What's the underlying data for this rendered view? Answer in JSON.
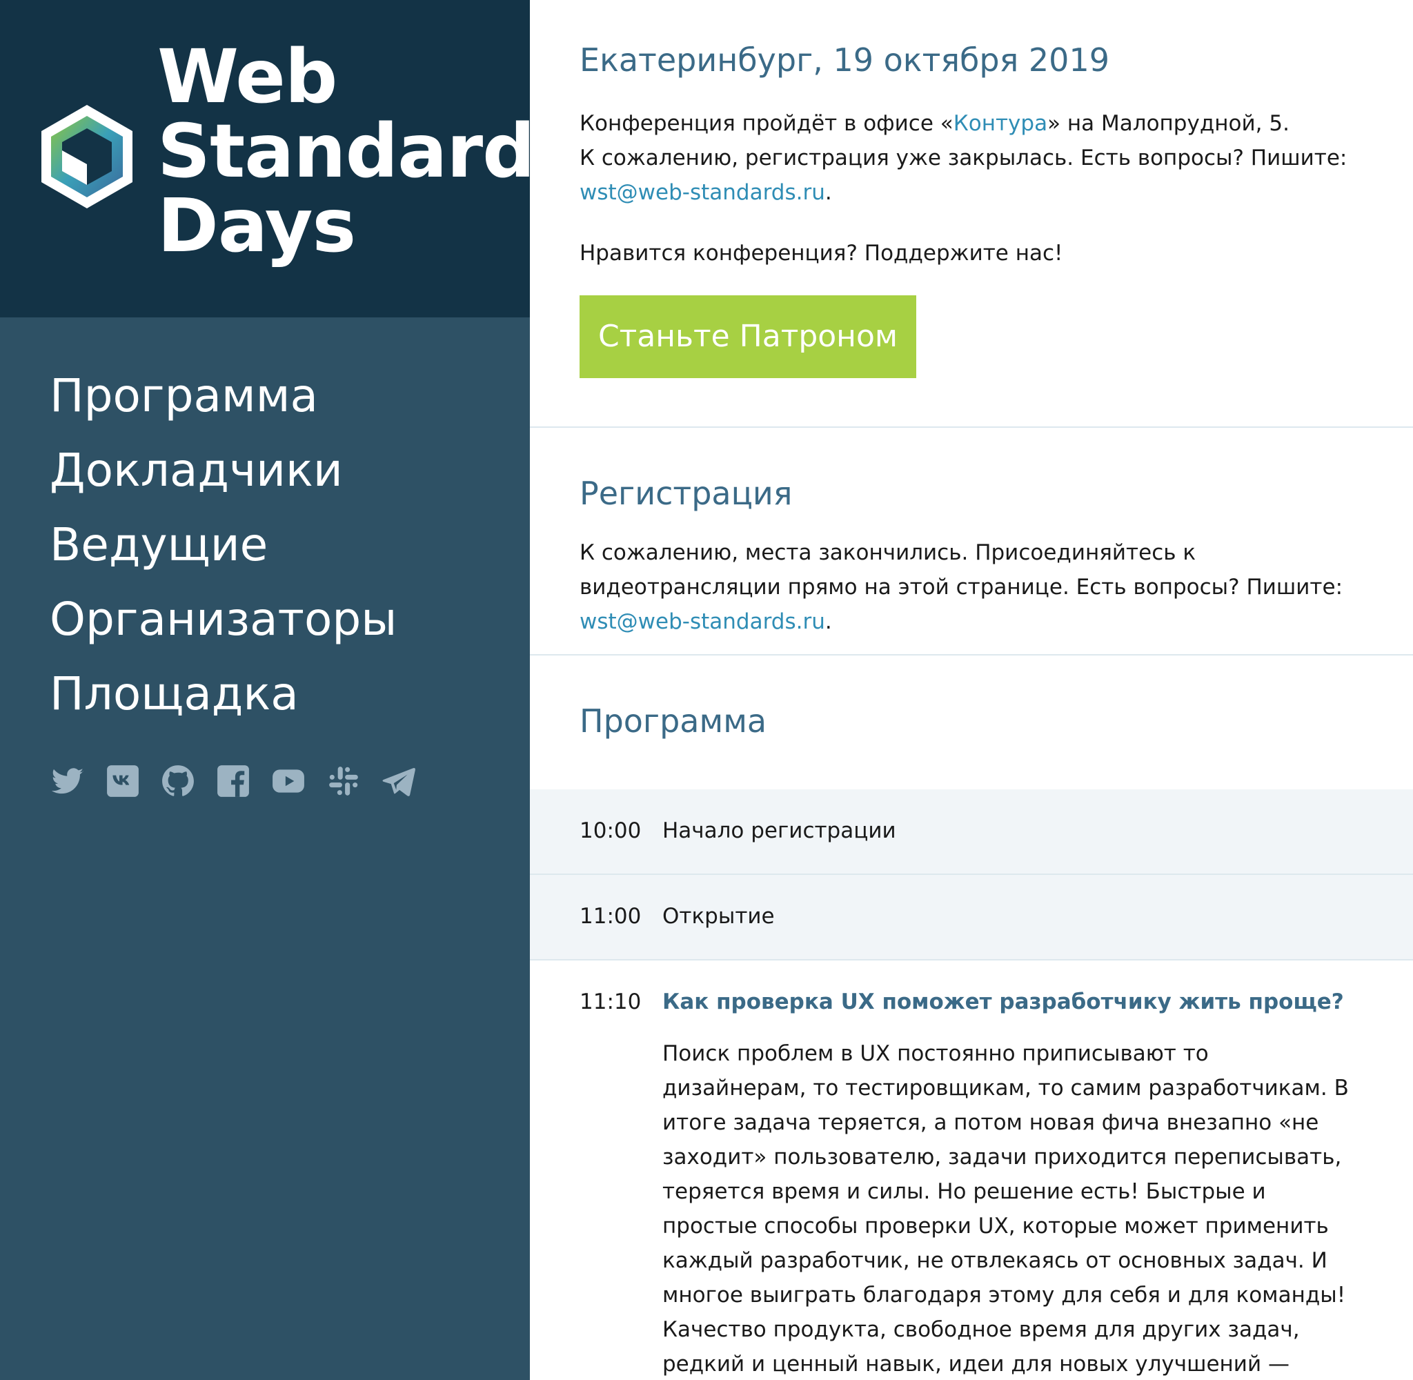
{
  "logo": {
    "line1": "Web",
    "line2": "Standards",
    "line3": "Days"
  },
  "nav": {
    "items": [
      "Программа",
      "Докладчики",
      "Ведущие",
      "Организаторы",
      "Площадка"
    ]
  },
  "socials": [
    "twitter-icon",
    "vk-icon",
    "github-icon",
    "facebook-icon",
    "youtube-icon",
    "slack-icon",
    "telegram-icon"
  ],
  "event": {
    "heading": "Екатеринбург, 19 октября 2019",
    "intro_pre": "Конференция пройдёт в офисе «",
    "intro_link": "Контура",
    "intro_post": "» на Малопрудной, 5.",
    "intro_line2": "К сожалению, регистрация уже закрылась. Есть вопросы? Пишите:",
    "email": "wst@web-standards.ru",
    "support_text": "Нравится конференция? Поддержите нас!",
    "patron_button": "Станьте Патроном"
  },
  "registration": {
    "heading": "Регистрация",
    "text": "К сожалению, места закончились. Присоединяйтесь к видеотрансляции прямо на этой странице. Есть вопросы? Пишите: ",
    "email": "wst@web-standards.ru"
  },
  "program": {
    "heading": "Программа",
    "items": [
      {
        "time": "10:00",
        "title": "Начало регистрации"
      },
      {
        "time": "11:00",
        "title": "Открытие"
      },
      {
        "time": "11:10",
        "title": "Как проверка UX поможет разработчику жить проще?",
        "description": "Поиск проблем в UX постоянно приписывают то дизайнерам, то тестировщикам, то самим разработчикам. В итоге задача теряется, а потом новая фича внезапно «не заходит» пользователю, задачи приходится переписывать, теряется время и силы. Но решение есть! Быстрые и простые способы проверки UX, которые может применить каждый разработчик, не отвлекаясь от основных задач. И многое выиграть благодаря этому для себя и для команды! Качество продукта, свободное время для других задач, редкий и ценный навык, идеи для новых улучшений — список можно продолжать дальше. А как"
      }
    ]
  },
  "colors": {
    "sidebar": "#2e5165",
    "logo_bg": "#133346",
    "heading": "#3b6a87",
    "link": "#2f8db5",
    "button": "#a7d043"
  }
}
